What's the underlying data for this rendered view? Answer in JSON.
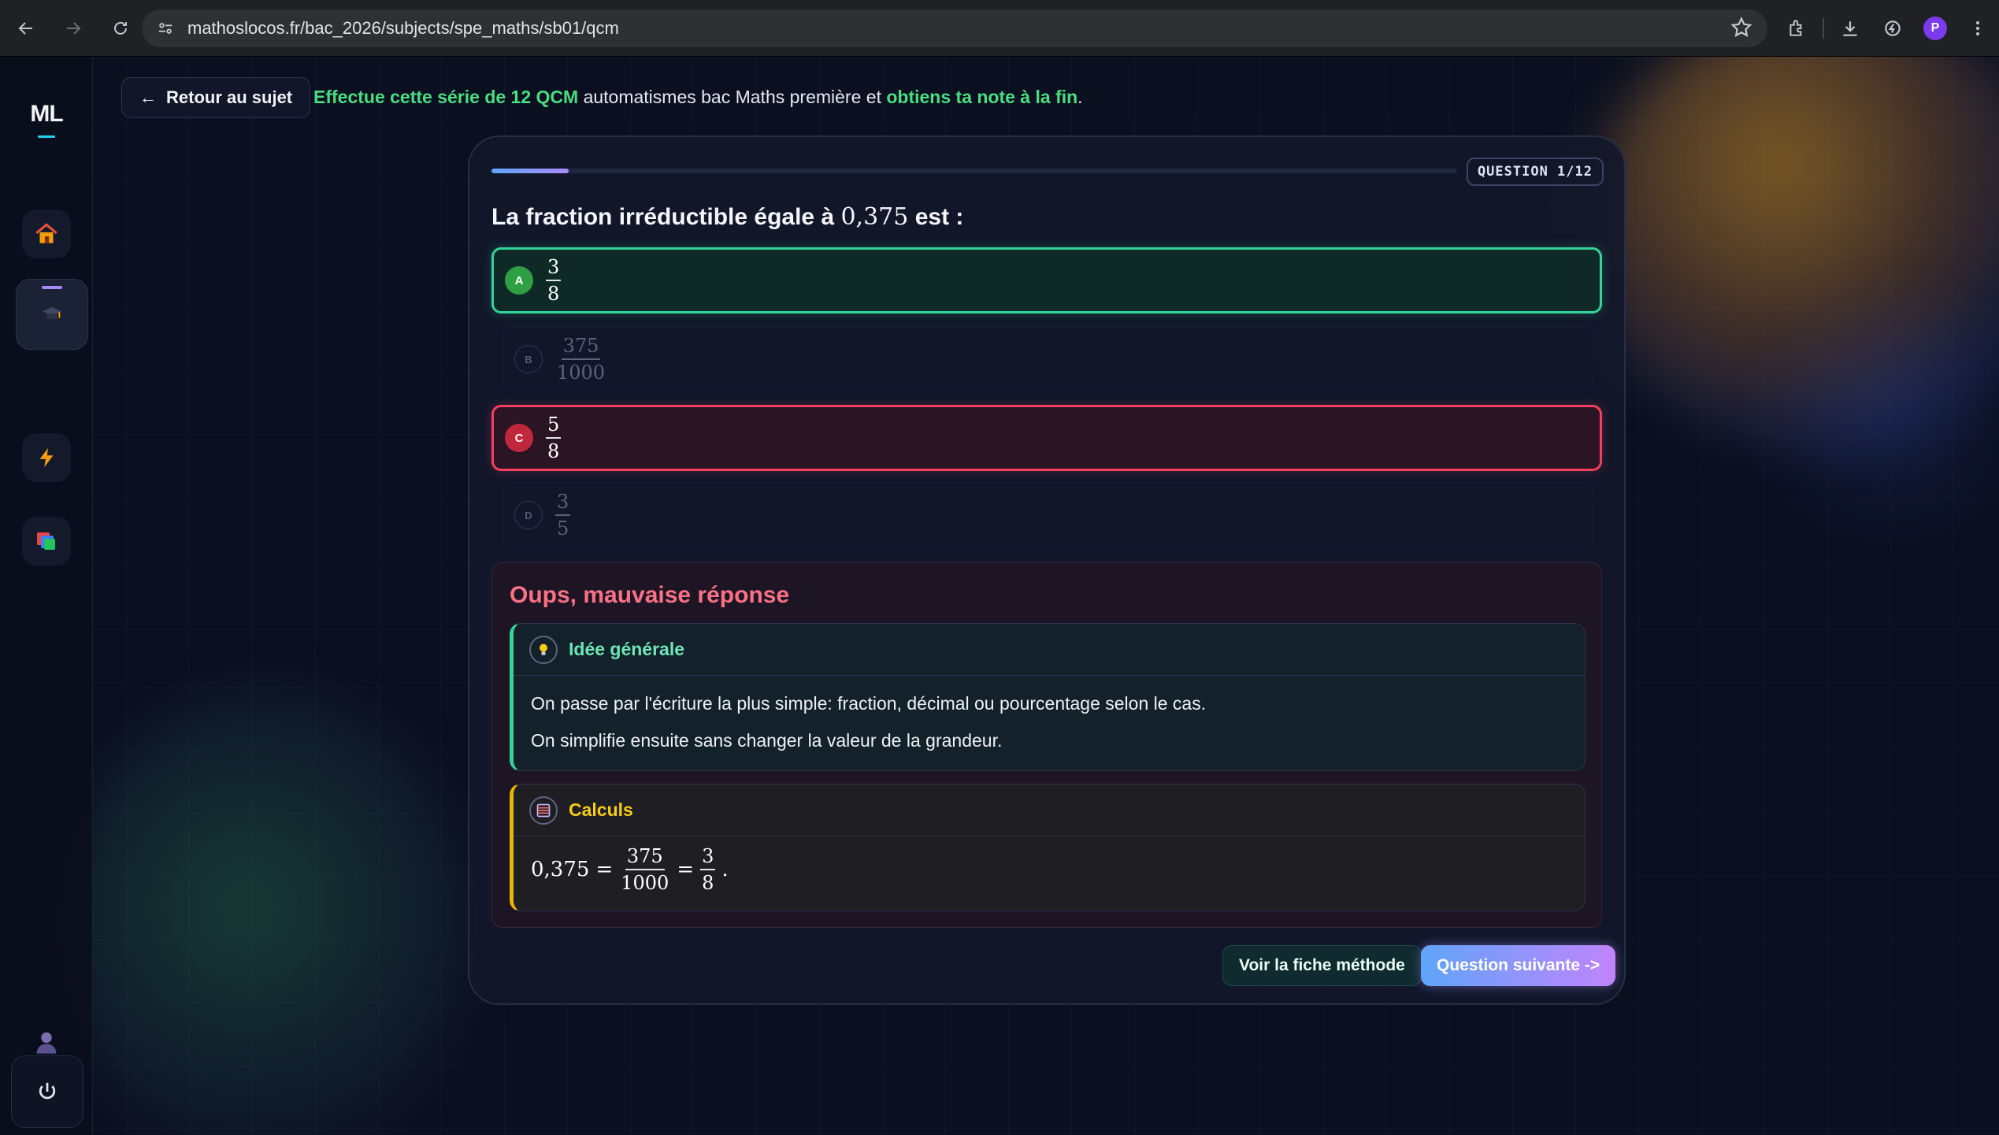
{
  "browser": {
    "url": "mathoslocos.fr/bac_2026/subjects/spe_maths/sb01/qcm",
    "profile_initial": "P"
  },
  "sidebar": {
    "logo": "ML",
    "items": [
      {
        "name": "home",
        "icon": "house-icon"
      },
      {
        "name": "subjects",
        "icon": "graduation-cap-icon",
        "active": true
      },
      {
        "name": "quick",
        "icon": "lightning-icon"
      },
      {
        "name": "cards",
        "icon": "cards-icon"
      }
    ],
    "user_icon": "user-icon",
    "power_icon": "power-icon"
  },
  "header": {
    "back_label": "Retour au sujet",
    "intro_hl1": "Effectue cette série de 12 QCM",
    "intro_mid": " automatismes bac Maths première et ",
    "intro_hl2": "obtiens ta note à la fin",
    "intro_end": "."
  },
  "quiz": {
    "badge": "QUESTION 1/12",
    "progress": 0.08,
    "question_prefix": "La fraction irréductible égale à ",
    "question_math": "0,375",
    "question_suffix": " est :",
    "options": [
      {
        "letter": "A",
        "num": "3",
        "den": "8",
        "state": "correct"
      },
      {
        "letter": "B",
        "num": "375",
        "den": "1000",
        "state": "muted"
      },
      {
        "letter": "C",
        "num": "5",
        "den": "8",
        "state": "wrong"
      },
      {
        "letter": "D",
        "num": "3",
        "den": "5",
        "state": "muted"
      }
    ]
  },
  "feedback": {
    "title": "Oups, mauvaise réponse",
    "idea_label": "Idée générale",
    "idea_line1": "On passe par l'écriture la plus simple: fraction, décimal ou pourcentage selon le cas.",
    "idea_line2": "On simplifie ensuite sans changer la valeur de la grandeur.",
    "calc_label": "Calculs",
    "calc_lhs": "0,375",
    "calc_eq": "=",
    "calc_f1_num": "375",
    "calc_f1_den": "1000",
    "calc_f2_num": "3",
    "calc_f2_den": "8",
    "calc_end": "."
  },
  "actions": {
    "method_label": "Voir la fiche méthode",
    "next_label": "Question suivante ->"
  },
  "colors": {
    "correct": "#34d399",
    "wrong": "#f43f5e",
    "accent": "#a78bfa",
    "highlight": "#4ade80"
  }
}
